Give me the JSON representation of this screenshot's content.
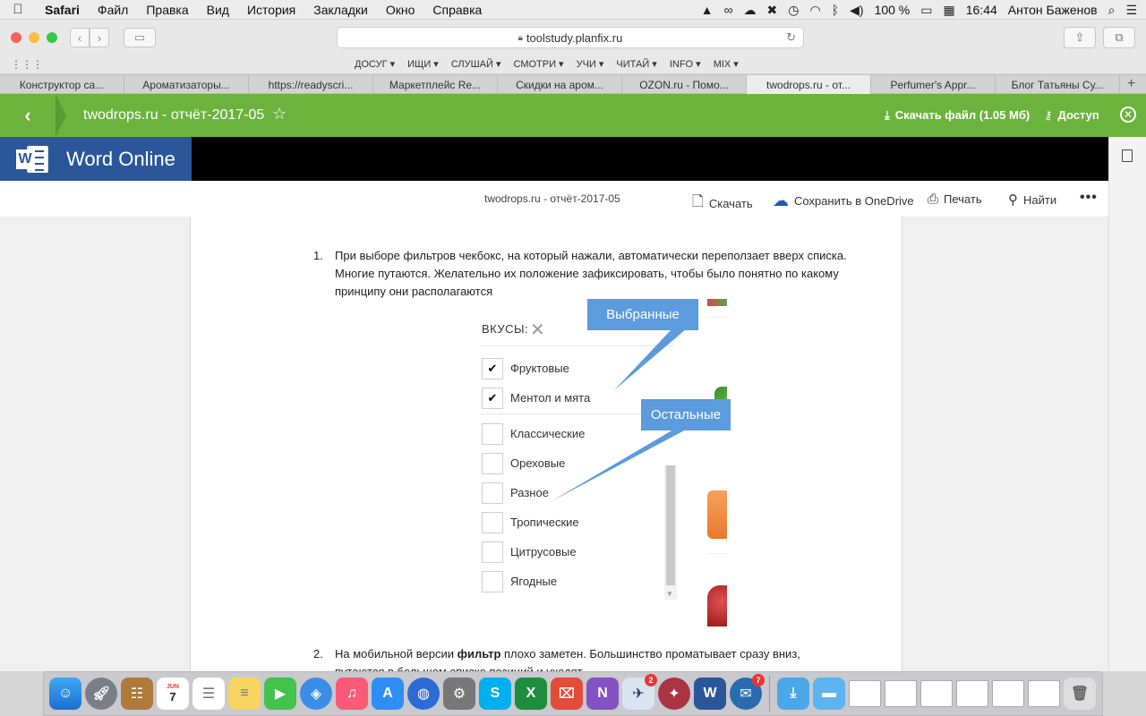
{
  "menubar": {
    "items": [
      "Safari",
      "Файл",
      "Правка",
      "Вид",
      "История",
      "Закладки",
      "Окно",
      "Справка"
    ],
    "battery": "100 %",
    "time": "16:44",
    "user": "Антон Баженов"
  },
  "browser": {
    "url": "toolstudy.planfix.ru",
    "bookmarks": [
      "ДОСУГ ▾",
      "ИЩИ ▾",
      "СЛУШАЙ ▾",
      "СМОТРИ ▾",
      "УЧИ ▾",
      "ЧИТАЙ ▾",
      "INFO ▾",
      "MIX ▾"
    ],
    "tabs": [
      "Конструктор са...",
      "Ароматизаторы...",
      "https://readyscri...",
      "Маркетплейс Re...",
      "Скидки на аром...",
      "OZON.ru - Помо...",
      "twodrops.ru - от...",
      "Perfumer's Appr...",
      "Блог Татьяны Су..."
    ],
    "active_tab": 6
  },
  "planfix": {
    "title": "twodrops.ru - отчёт-2017-05",
    "download_label": "Скачать файл (1.05 Мб)",
    "access_label": "Доступ"
  },
  "word": {
    "app_name": "Word Online",
    "doc_name": "twodrops.ru - отчёт-2017-05",
    "actions": {
      "download": "Скачать",
      "save_onedrive": "Сохранить в OneDrive",
      "print": "Печать",
      "find": "Найти"
    }
  },
  "document": {
    "item1_num": "1.",
    "item1_text": "При выборе фильтров чекбокс, на который нажали, автоматически переползает вверх списка. Многие путаются. Желательно их положение зафиксировать, чтобы было понятно по какому принципу они располагаются",
    "item2_num": "2.",
    "item2_text_before": "На мобильной версии ",
    "item2_text_bold": "фильтр",
    "item2_text_after": " плохо заметен. Большинство проматывает сразу вниз, путаются в большом списке позиций и уходят",
    "embed": {
      "label": "ВКУСЫ:",
      "selected": [
        "Фруктовые",
        "Ментол и мята"
      ],
      "others": [
        "Классические",
        "Ореховые",
        "Разное",
        "Тропические",
        "Цитрусовые",
        "Ягодные"
      ],
      "callout_selected": "Выбранные",
      "callout_others": "Остальные"
    }
  },
  "dock": {
    "badge_mail": "2",
    "badge_thunderbird": "7",
    "calendar_month": "JUN",
    "calendar_day": "7"
  }
}
